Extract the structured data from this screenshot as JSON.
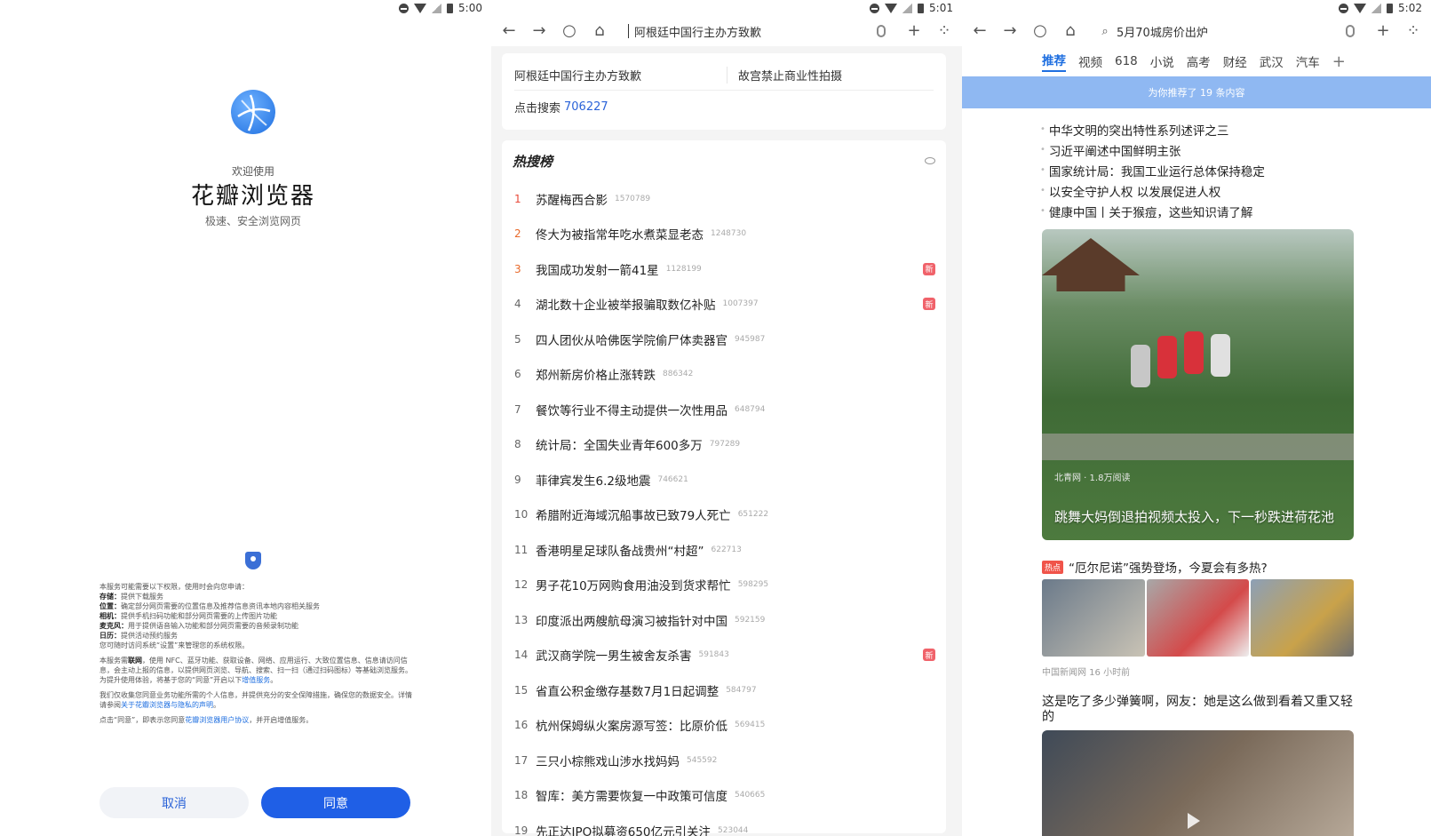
{
  "panel1": {
    "status_time": "5:00",
    "welcome_sub": "欢迎使用",
    "app_name": "花瓣浏览器",
    "tagline": "极速、安全浏览网页",
    "permissions_intro": "本服务可能需要以下权限，使用时会向您申请：",
    "permissions": [
      {
        "name": "存储：",
        "desc": "提供下载服务"
      },
      {
        "name": "位置：",
        "desc": "确定部分网页需要的位置信息及推荐信息资讯本地内容相关服务"
      },
      {
        "name": "相机：",
        "desc": "提供手机扫码功能和部分网页需要的上传图片功能"
      },
      {
        "name": "麦克风：",
        "desc": "用于提供语音输入功能和部分网页需要的音频录制功能"
      },
      {
        "name": "日历：",
        "desc": "提供活动预约服务"
      }
    ],
    "permissions_note": "您可随时访问系统“设置”来管理您的系统权限。",
    "para2_prefix": "本服务需",
    "para2_bold": "联网",
    "para2_rest": "，使用 NFC、蓝牙功能、获取设备、网络、应用运行、大致位置信息、信息请访问信息，会主动上报的信息，以提供网页浏览、导航、搜索、扫一扫（通过扫码图标）等基础浏览服务。为提升使用体验，将基于您的“同意”开启以下",
    "para2_link": "增值服务",
    "para3": "我们仅收集您同意业务功能所需的个人信息，并提供充分的安全保障措施，确保您的数据安全。详情请参阅",
    "para3_link": "关于花瓣浏览器与隐私的声明",
    "para4": "点击“同意”，即表示您同意",
    "para4_link": "花瓣浏览器用户协议",
    "para4_rest": "，并开启增值服务。",
    "cancel_label": "取消",
    "agree_label": "同意"
  },
  "panel2": {
    "status_time": "5:01",
    "address_text": "阿根廷中国行主办方致歉",
    "suggestions": [
      "阿根廷中国行主办方致歉",
      "故宫禁止商业性拍摄"
    ],
    "search_prefix": "点击搜索",
    "search_code": "706227",
    "hot_title": "热搜榜",
    "hot_list": [
      {
        "rank": "1",
        "text": "苏醒梅西合影",
        "count": "1570789",
        "badge": ""
      },
      {
        "rank": "2",
        "text": "佟大为被指常年吃水煮菜显老态",
        "count": "1248730",
        "badge": ""
      },
      {
        "rank": "3",
        "text": "我国成功发射一箭41星",
        "count": "1128199",
        "badge": "新"
      },
      {
        "rank": "4",
        "text": "湖北数十企业被举报骗取数亿补贴",
        "count": "1007397",
        "badge": "新"
      },
      {
        "rank": "5",
        "text": "四人团伙从哈佛医学院偷尸体卖器官",
        "count": "945987",
        "badge": ""
      },
      {
        "rank": "6",
        "text": "郑州新房价格止涨转跌",
        "count": "886342",
        "badge": ""
      },
      {
        "rank": "7",
        "text": "餐饮等行业不得主动提供一次性用品",
        "count": "648794",
        "badge": ""
      },
      {
        "rank": "8",
        "text": "统计局：全国失业青年600多万",
        "count": "797289",
        "badge": ""
      },
      {
        "rank": "9",
        "text": "菲律宾发生6.2级地震",
        "count": "746621",
        "badge": ""
      },
      {
        "rank": "10",
        "text": "希腊附近海域沉船事故已致79人死亡",
        "count": "651222",
        "badge": ""
      },
      {
        "rank": "11",
        "text": "香港明星足球队备战贵州“村超”",
        "count": "622713",
        "badge": ""
      },
      {
        "rank": "12",
        "text": "男子花10万网购食用油没到货求帮忙",
        "count": "598295",
        "badge": ""
      },
      {
        "rank": "13",
        "text": "印度派出两艘航母演习被指针对中国",
        "count": "592159",
        "badge": ""
      },
      {
        "rank": "14",
        "text": "武汉商学院一男生被舍友杀害",
        "count": "591843",
        "badge": "新"
      },
      {
        "rank": "15",
        "text": "省直公积金缴存基数7月1日起调整",
        "count": "584797",
        "badge": ""
      },
      {
        "rank": "16",
        "text": "杭州保姆纵火案房源写签：比原价低",
        "count": "569415",
        "badge": ""
      },
      {
        "rank": "17",
        "text": "三只小棕熊戏山涉水找妈妈",
        "count": "545592",
        "badge": ""
      },
      {
        "rank": "18",
        "text": "智库：美方需要恢复一中政策可信度",
        "count": "540665",
        "badge": ""
      },
      {
        "rank": "19",
        "text": "先正达IPO拟募资650亿元引关注",
        "count": "523044",
        "badge": ""
      }
    ]
  },
  "panel3": {
    "status_time": "5:02",
    "address_text": "5月70城房价出炉",
    "tabs": [
      "推荐",
      "视频",
      "618",
      "小说",
      "高考",
      "财经",
      "武汉",
      "汽车"
    ],
    "banner": "为你推荐了 19 条内容",
    "news": [
      "中华文明的突出特性系列述评之三",
      "习近平阐述中国鲜明主张",
      "国家统计局：我国工业运行总体保持稳定",
      "以安全守护人权 以发展促进人权",
      "健康中国丨关于猴痘，这些知识请了解"
    ],
    "card1_meta": "北青网 · 1.8万阅读",
    "card1_caption": "跳舞大妈倒退拍视频太投入，下一秒跌进荷花池",
    "article2_tag": "热点",
    "article2_title": "“厄尔尼诺”强势登场，今夏会有多热?",
    "article2_meta": "中国新闻网   16 小时前",
    "article3_title": "这是吃了多少弹簧啊，网友：她是这么做到看着又重又轻的"
  },
  "colors": {
    "accent": "#1f5fe6",
    "hot_badge": "#f0626a",
    "banner": "#8fb8f2"
  }
}
